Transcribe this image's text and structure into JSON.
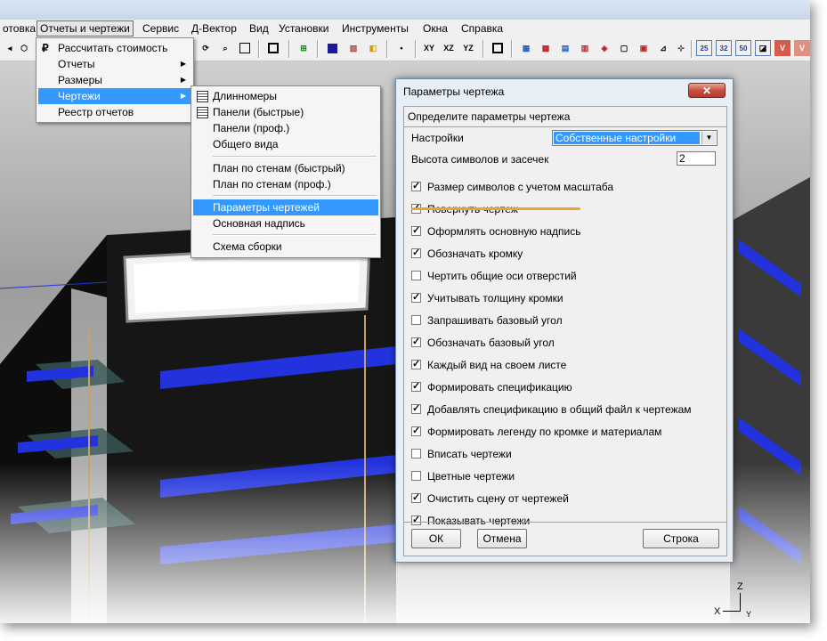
{
  "menubar": {
    "items": [
      "отовка",
      "Отчеты и чертежи",
      "Сервис",
      "Д-Вектор",
      "Вид",
      "Установки",
      "Инструменты",
      "Окна",
      "Справка"
    ]
  },
  "toolbar": {
    "buttons": [
      "XY",
      "XZ",
      "YZ",
      "25",
      "32",
      "50"
    ]
  },
  "reports_menu": {
    "items": [
      {
        "label": "Рассчитать стоимость",
        "icon": "ruble-icon"
      },
      {
        "label": "Отчеты",
        "submenu": true
      },
      {
        "label": "Размеры",
        "submenu": true
      },
      {
        "label": "Чертежи",
        "submenu": true,
        "highlighted": true
      },
      {
        "label": "Реестр отчетов"
      }
    ]
  },
  "drawings_menu": {
    "items": [
      {
        "label": "Длинномеры",
        "icon": "table-icon"
      },
      {
        "label": "Панели (быстрые)",
        "icon": "table-icon"
      },
      {
        "label": "Панели (проф.)"
      },
      {
        "label": "Общего вида"
      },
      {
        "label": "План по стенам (быстрый)"
      },
      {
        "label": "План по стенам (проф.)"
      },
      {
        "label": "Параметры чертежей",
        "highlighted": true
      },
      {
        "label": "Основная надпись"
      },
      {
        "label": "Схема сборки"
      }
    ]
  },
  "dialog": {
    "title": "Параметры чертежа",
    "close_label": "✕",
    "group_title": "Определите параметры чертежа",
    "settings_label": "Настройки",
    "settings_value": "Собственные настройки",
    "height_label": "Высота символов и засечек",
    "height_value": "2",
    "checkboxes": [
      {
        "label": "Размер символов с учетом масштаба",
        "checked": true
      },
      {
        "label": "Повернуть чертеж",
        "checked": true
      },
      {
        "label": "Оформлять основную надпись",
        "checked": true
      },
      {
        "label": "Обозначать кромку",
        "checked": true
      },
      {
        "label": "Чертить общие оси отверстий",
        "checked": false
      },
      {
        "label": "Учитывать толщину кромки",
        "checked": true
      },
      {
        "label": "Запрашивать базовый угол",
        "checked": false
      },
      {
        "label": "Обозначать базовый угол",
        "checked": true
      },
      {
        "label": "Каждый вид на своем листе",
        "checked": true
      },
      {
        "label": "Формировать спецификацию",
        "checked": true
      },
      {
        "label": "Добавлять спецификацию в общий файл к чертежам",
        "checked": true
      },
      {
        "label": "Формировать легенду по кромке и материалам",
        "checked": true
      },
      {
        "label": "Вписать чертежи",
        "checked": false
      },
      {
        "label": "Цветные чертежи",
        "checked": false
      },
      {
        "label": "Очистить сцену от  чертежей",
        "checked": true
      },
      {
        "label": "Показывать чертежи",
        "checked": true
      }
    ],
    "ok_label": "ОК",
    "cancel_label": "Отмена",
    "line_label": "Строка"
  },
  "axes": {
    "z": "Z",
    "x": "X",
    "y": "Y"
  },
  "colors": {
    "highlight": "#3399ff",
    "annotation": "#f0a030",
    "shelf_blue": "#1a2fd6"
  }
}
